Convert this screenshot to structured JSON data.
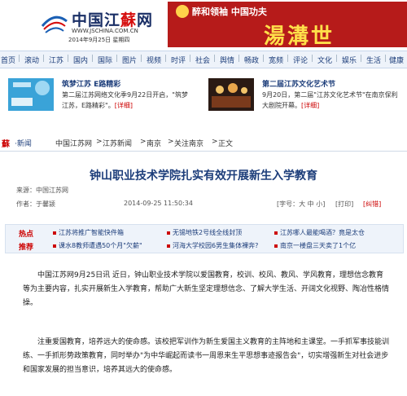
{
  "site": {
    "name_prefix": "中国江",
    "name_red": "蘇",
    "name_suffix": "网",
    "url": "WWW.JSCHINA.COM.CN",
    "date": "2014年9月25日 星期四"
  },
  "banner": {
    "sub": "醉和领袖  中国功夫",
    "main": "湯溝世"
  },
  "nav": [
    "首页",
    "滚动",
    "江苏",
    "国内",
    "国际",
    "图片",
    "视频",
    "时评",
    "社会",
    "舆情",
    "畅政",
    "宽频",
    "评论",
    "文化",
    "娱乐",
    "生活",
    "健康"
  ],
  "features": [
    {
      "title": "筑梦江苏  E路精彩",
      "text": "第二届江苏网络文化季9月22日开启，\"筑梦江苏，E路精彩\"。",
      "more": "[详细]"
    },
    {
      "title": "第二届江苏文化艺术节",
      "text": "9月20日，第二届\"江苏文化艺术节\"在南京保利大剧院开幕。",
      "more": "[详细]"
    }
  ],
  "breadcrumb": {
    "logo": "蘇",
    "news": "·新闻",
    "path": [
      "中国江苏网",
      "江苏新闻",
      "南京",
      "关注南京",
      "正文"
    ]
  },
  "article": {
    "title": "钟山职业技术学院扎实有效开展新生入学教育",
    "source": "来源：中国江苏网",
    "author": "作者：于馨颍",
    "time": "2014-09-25  11:50:34",
    "font_size": "[字号：大  中  小]",
    "print": "[打印]",
    "report": "[纠错]"
  },
  "hot": {
    "label1": "热点",
    "label2": "推荐",
    "row1": [
      "江苏将推广智能快件箱",
      "无锡地铁2号线全线封顶",
      "江苏哪人最能喝酒？竟是太仓"
    ],
    "row2": [
      "课水8教师遭遇50个月\"欠薪\"",
      "河海大学校园6男生集体裸奔?",
      "南京一楼盘三天卖了1个亿"
    ]
  },
  "body": {
    "p1": "中国江苏网9月25日讯  近日，钟山职业技术学院以爱国教育，校训、校风、教风、学风教育，理想信念教育等为主要内容，扎实开展新生入学教育，帮助广大新生坚定理想信念、了解大学生活、开阔文化视野、陶冶性格情操。",
    "p2": "注重爱国教育，培养远大的使命感。该校把军训作为新生爱国主义教育的主阵地和主课堂。一手抓军事技能训练、一手抓形势政策教育，同时举办\"为中华崛起而读书一周恩来生平思想事迹报告会\"，切实增强新生对社会进步和国家发展的担当意识，培养其远大的使命感。"
  },
  "colors": {
    "brand_blue": "#1c3d7a",
    "accent_red": "#c00",
    "banner_red": "#b61b1a"
  }
}
